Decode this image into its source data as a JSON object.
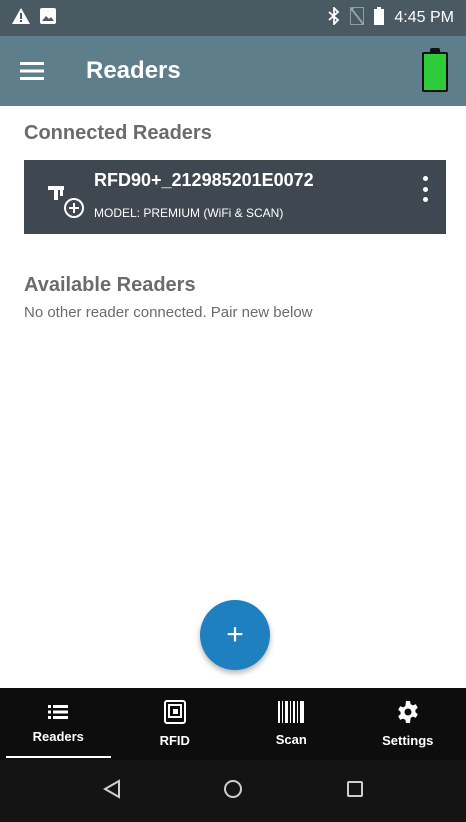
{
  "status_bar": {
    "time": "4:45 PM",
    "icons": [
      "alert-icon",
      "image-icon",
      "bluetooth-icon",
      "no-sim-icon",
      "battery-icon"
    ]
  },
  "app_bar": {
    "title": "Readers",
    "battery_color": "#2ecc3a"
  },
  "connected": {
    "title": "Connected Readers",
    "reader": {
      "name": "RFD90+_212985201E0072",
      "model": "MODEL: PREMIUM (WiFi & SCAN)"
    }
  },
  "available": {
    "title": "Available Readers",
    "message": "No other reader connected. Pair new below"
  },
  "fab": {
    "label": "+"
  },
  "bottom_nav": {
    "items": [
      {
        "label": "Readers",
        "icon": "list-icon",
        "active": true
      },
      {
        "label": "RFID",
        "icon": "rfid-icon",
        "active": false
      },
      {
        "label": "Scan",
        "icon": "barcode-icon",
        "active": false
      },
      {
        "label": "Settings",
        "icon": "gear-icon",
        "active": false
      }
    ]
  },
  "colors": {
    "status_bar": "#4a5a63",
    "app_bar": "#5f7e8b",
    "card": "#3f4850",
    "fab": "#1f80c0"
  }
}
